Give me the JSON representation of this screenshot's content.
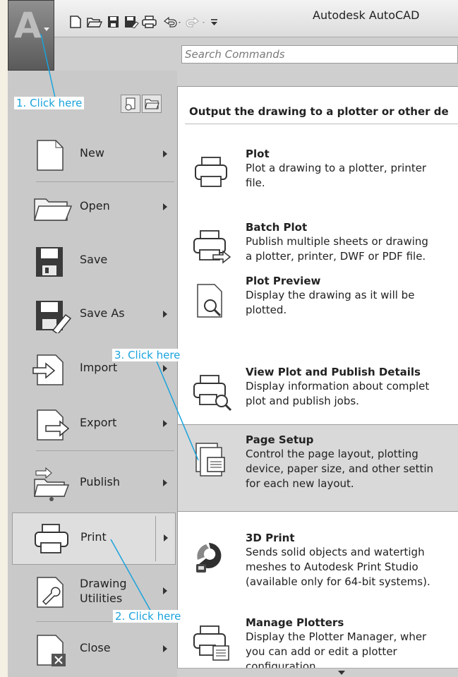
{
  "window": {
    "title": "Autodesk AutoCAD"
  },
  "search": {
    "placeholder": "Search Commands"
  },
  "quick_access": [
    "new-icon",
    "open-icon",
    "save-icon",
    "save-as-icon",
    "print-icon",
    "undo-icon",
    "redo-icon",
    "customize-icon"
  ],
  "menu": {
    "items": [
      {
        "id": "new",
        "label": "New",
        "has_submenu": true
      },
      {
        "id": "open",
        "label": "Open",
        "has_submenu": true
      },
      {
        "id": "save",
        "label": "Save",
        "has_submenu": false
      },
      {
        "id": "save-as",
        "label": "Save As",
        "has_submenu": true
      },
      {
        "id": "import",
        "label": "Import",
        "has_submenu": true
      },
      {
        "id": "export",
        "label": "Export",
        "has_submenu": true
      },
      {
        "id": "publish",
        "label": "Publish",
        "has_submenu": true
      },
      {
        "id": "print",
        "label": "Print",
        "has_submenu": true,
        "selected": true
      },
      {
        "id": "drawing-utilities",
        "label_line1": "Drawing",
        "label_line2": "Utilities",
        "has_submenu": true
      },
      {
        "id": "close",
        "label": "Close",
        "has_submenu": true
      }
    ]
  },
  "panel": {
    "header": "Output the drawing to a plotter or other de",
    "items": [
      {
        "title": "Plot",
        "desc": "Plot a drawing to a plotter, printer",
        "desc2": "file."
      },
      {
        "title": "Batch Plot",
        "desc": "Publish multiple sheets or drawing",
        "desc2": "a plotter, printer, DWF or PDF file."
      },
      {
        "title": "Plot Preview",
        "desc": "Display the drawing as it will be",
        "desc2": "plotted."
      },
      {
        "title": "View Plot and Publish Details",
        "desc": "Display information about complet",
        "desc2": "plot and publish jobs."
      },
      {
        "title": "Page Setup",
        "desc": "Control the page layout, plotting",
        "desc2": "device, paper size, and other settin",
        "desc3": "for each new layout.",
        "highlighted": true
      },
      {
        "title": "3D Print",
        "desc": "Sends solid objects and watertigh",
        "desc2": "meshes to Autodesk Print Studio",
        "desc3": "(available only for 64-bit systems)."
      },
      {
        "title": "Manage Plotters",
        "desc": "Display the Plotter Manager, wher",
        "desc2": "you can add or edit a plotter",
        "desc3": "configuration"
      }
    ]
  },
  "callouts": {
    "step1": "1. Click here",
    "step2": "2. Click here",
    "step3": "3. Click here"
  },
  "colors": {
    "callout": "#1aa3dc",
    "highlight": "#d9d9d9",
    "menu_bg": "#c9c9c9"
  }
}
